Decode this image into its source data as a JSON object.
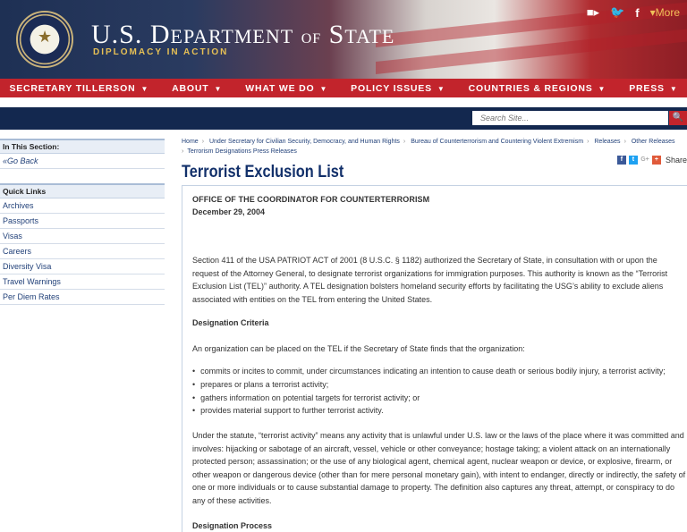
{
  "header": {
    "title_main_1": "U.S. D",
    "title_small_1": "EPARTMENT",
    "title_of": "OF",
    "title_main_2": "S",
    "title_small_2": "TATE",
    "tagline": "DIPLOMACY IN ACTION",
    "more_label": "More"
  },
  "nav": {
    "items": [
      "SECRETARY TILLERSON",
      "ABOUT",
      "WHAT WE DO",
      "POLICY ISSUES",
      "COUNTRIES & REGIONS",
      "PRESS"
    ]
  },
  "search": {
    "placeholder": "Search Site..."
  },
  "sidebar": {
    "in_section_heading": "In This Section:",
    "go_back": "Go Back",
    "quick_links_heading": "Quick Links",
    "quick_links": [
      "Archives",
      "Passports",
      "Visas",
      "Careers",
      "Diversity Visa",
      "Travel Warnings",
      "Per Diem Rates"
    ]
  },
  "breadcrumb": {
    "items": [
      "Home",
      "Under Secretary for Civilian Security, Democracy, and Human Rights",
      "Bureau of Counterterrorism and Countering Violent Extremism",
      "Releases",
      "Other Releases",
      "Terrorism Designations Press Releases"
    ]
  },
  "page": {
    "title": "Terrorist Exclusion List",
    "share_label": "Share"
  },
  "article": {
    "office": "OFFICE OF THE COORDINATOR FOR COUNTERTERRORISM",
    "date": "December 29, 2004",
    "intro": "Section 411 of the USA PATRIOT ACT of 2001 (8 U.S.C. § 1182) authorized the Secretary of State, in consultation with or upon the request of the Attorney General, to designate terrorist organizations for immigration purposes. This authority is known as the “Terrorist Exclusion List (TEL)” authority. A TEL designation bolsters homeland security efforts by facilitating the USG’s ability to exclude aliens associated with entities on the TEL from entering the United States.",
    "criteria_heading": "Designation Criteria",
    "criteria_intro": "An organization can be placed on the TEL if the Secretary of State finds that the organization:",
    "criteria_bullets": [
      "commits or incites to commit, under circumstances indicating an intention to cause death or serious bodily injury, a terrorist activity;",
      "prepares or plans a terrorist activity;",
      "gathers information on potential targets for terrorist activity; or",
      "provides material support to further terrorist activity."
    ],
    "statute_para": "Under the statute, “terrorist activity” means any activity that is unlawful under U.S. law or the laws of the place where it was committed and involves: hijacking or sabotage of an aircraft, vessel, vehicle or other conveyance; hostage taking; a violent attack on an internationally protected person; assassination; or the use of any biological agent, chemical agent, nuclear weapon or device, or explosive, firearm, or other weapon or dangerous device (other than for mere personal monetary gain), with intent to endanger, directly or indirectly, the safety of one or more individuals or to cause substantial damage to property. The definition also captures any threat, attempt, or conspiracy to do any of these activities.",
    "process_heading": "Designation Process"
  },
  "colors": {
    "nav_red": "#c2242c",
    "navy": "#13284f",
    "link_blue": "#23427a",
    "title_blue": "#12306a"
  }
}
